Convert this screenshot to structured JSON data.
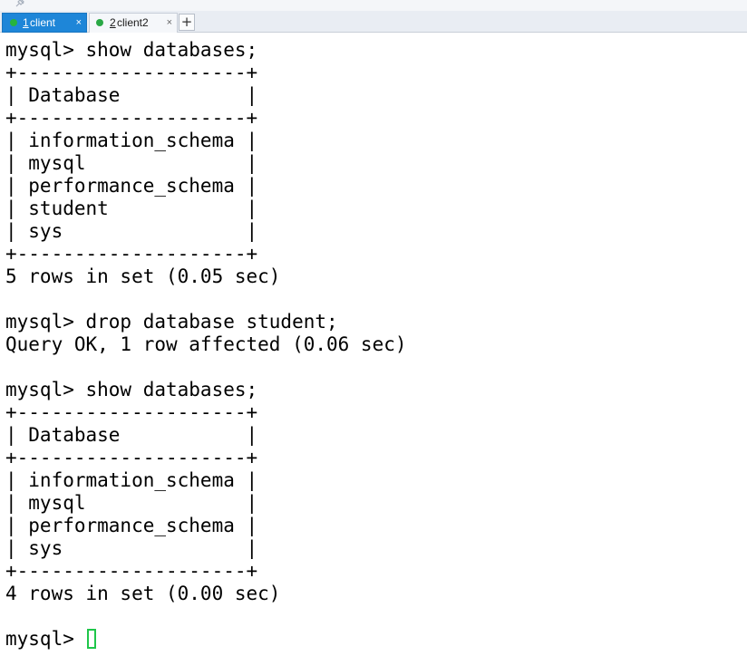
{
  "tabs": [
    {
      "number": "1",
      "label": "client",
      "status_color": "#27b43e",
      "active": true,
      "close_glyph": "×"
    },
    {
      "number": "2",
      "label": "client2",
      "status_color": "#2aa845",
      "active": false,
      "close_glyph": "×"
    }
  ],
  "new_tab_glyph": "+",
  "terminal": {
    "lines": [
      "mysql> show databases;",
      "+--------------------+",
      "| Database           |",
      "+--------------------+",
      "| information_schema |",
      "| mysql              |",
      "| performance_schema |",
      "| student            |",
      "| sys                |",
      "+--------------------+",
      "5 rows in set (0.05 sec)",
      "",
      "mysql> drop database student;",
      "Query OK, 1 row affected (0.06 sec)",
      "",
      "mysql> show databases;",
      "+--------------------+",
      "| Database           |",
      "+--------------------+",
      "| information_schema |",
      "| mysql              |",
      "| performance_schema |",
      "| sys                |",
      "+--------------------+",
      "4 rows in set (0.00 sec)",
      "",
      "mysql> "
    ],
    "cursor_color": "#1fc64a"
  }
}
